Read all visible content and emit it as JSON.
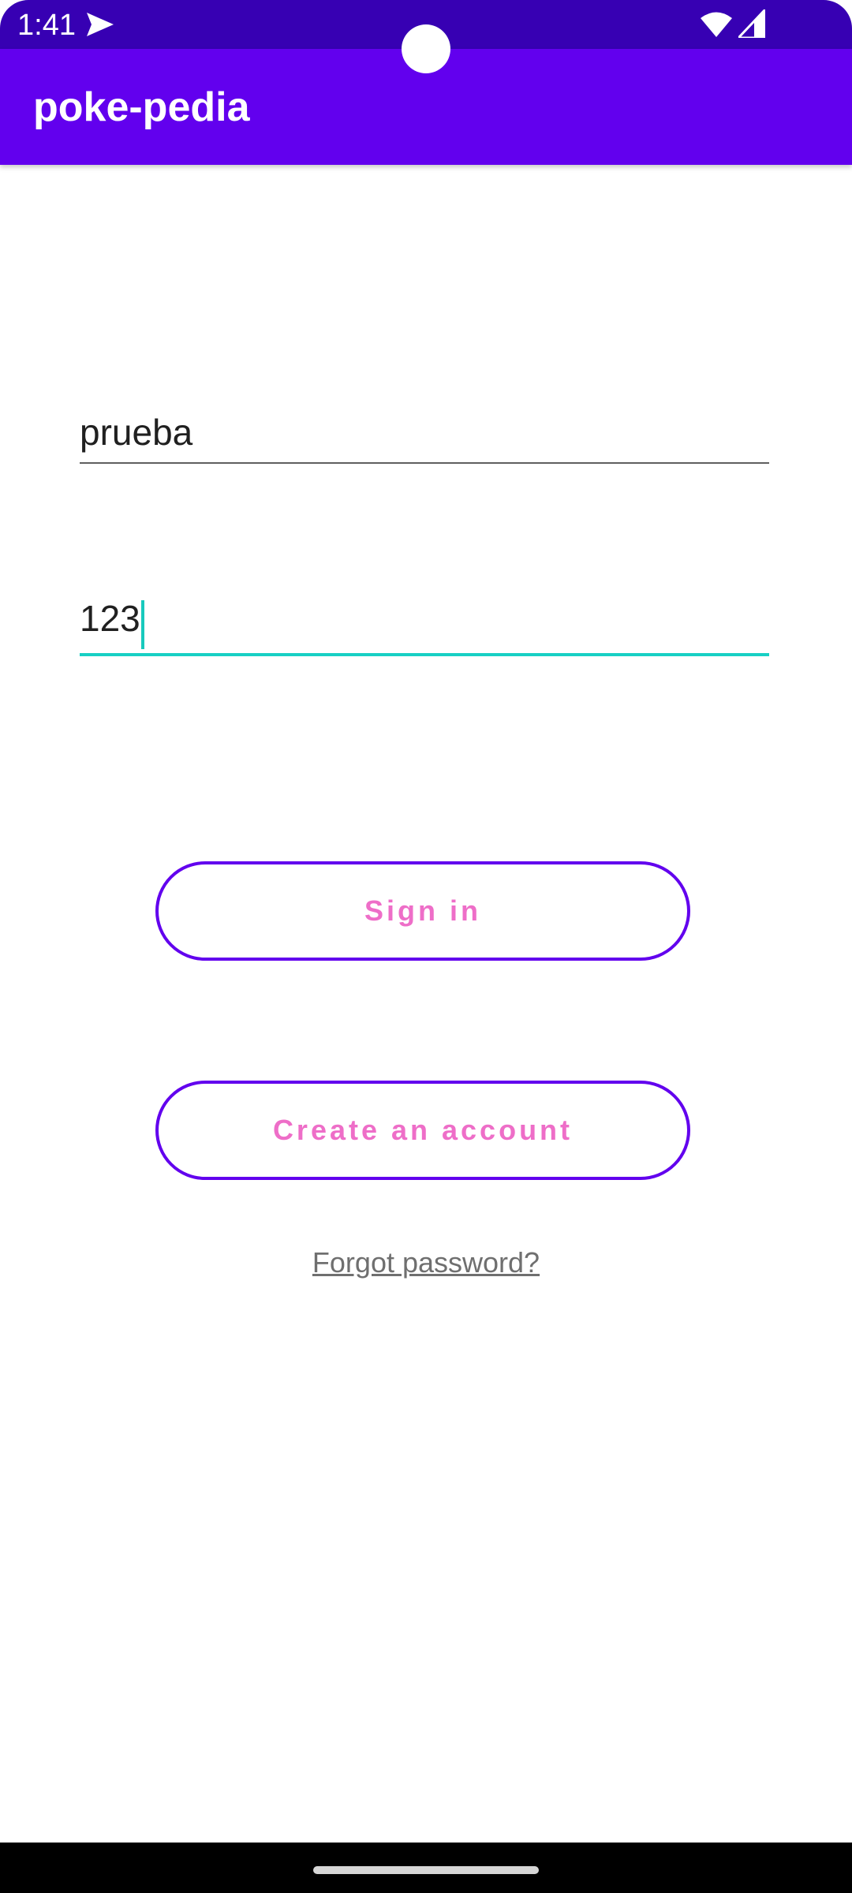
{
  "status_bar": {
    "time": "1:41",
    "icons": [
      "send-icon",
      "wifi-icon",
      "signal-icon"
    ]
  },
  "app_bar": {
    "title": "poke-pedia"
  },
  "login_form": {
    "username_value": "prueba",
    "password_value": "123",
    "sign_in_label": "Sign in",
    "create_account_label": "Create an account",
    "forgot_password_label": "Forgot password?"
  },
  "colors": {
    "status_bar": "#3700b3",
    "app_bar": "#6200ee",
    "button_border": "#6200ee",
    "button_text": "#ee6ec8",
    "focus_accent": "#18d0c4"
  }
}
